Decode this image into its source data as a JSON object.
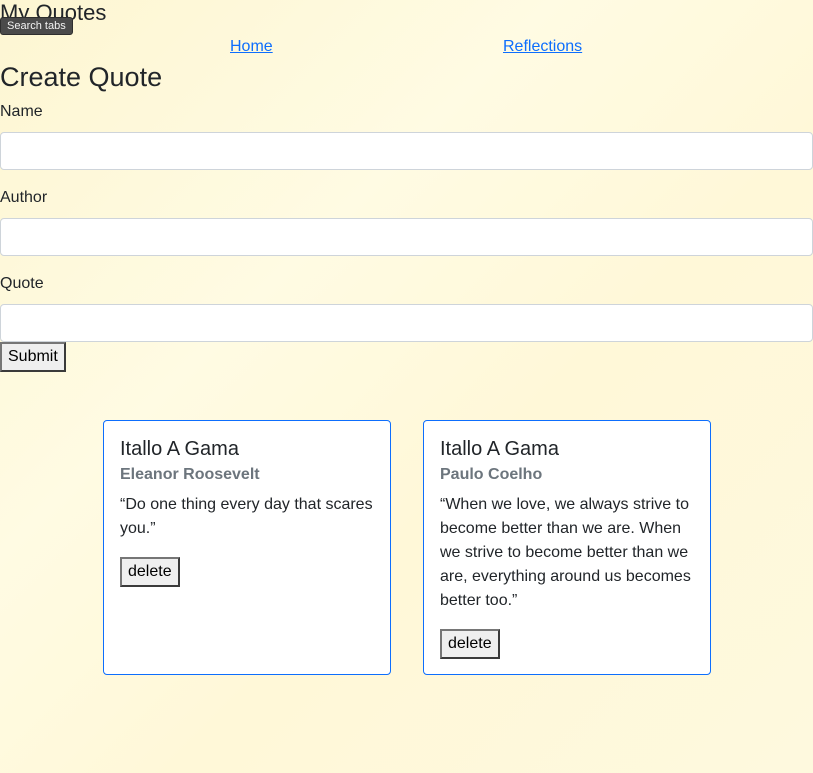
{
  "header": {
    "site_title": "My Quotes",
    "tooltip": "Search tabs"
  },
  "nav": {
    "home_label": "Home",
    "reflections_label": "Reflections"
  },
  "form": {
    "title": "Create Quote",
    "name_label": "Name",
    "name_value": "",
    "author_label": "Author",
    "author_value": "",
    "quote_label": "Quote",
    "quote_value": "",
    "submit_label": "Submit"
  },
  "quotes": [
    {
      "name": "Itallo A Gama",
      "author": "Eleanor Roosevelt",
      "text": "“Do one thing every day that scares you.”",
      "delete_label": "delete"
    },
    {
      "name": "Itallo A Gama",
      "author": "Paulo Coelho",
      "text": "“When we love, we always strive to become better than we are. When we strive to become better than we are, everything around us becomes better too.”",
      "delete_label": "delete"
    }
  ],
  "colors": {
    "link": "#0d6efd",
    "card_border": "#0d6efd",
    "subtitle": "#6c757d",
    "background": "#fffbe3"
  }
}
